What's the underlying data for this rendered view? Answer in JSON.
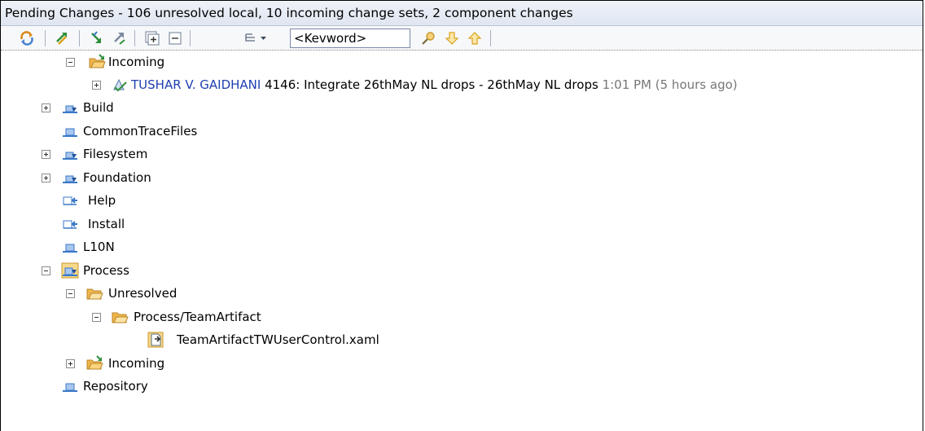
{
  "title": "Pending Changes - 106 unresolved local, 10 incoming change sets, 2 component changes",
  "toolbar": {
    "keyword_value": "<Kevword>",
    "buttons": [
      {
        "name": "refresh-icon"
      },
      {
        "name": "check-in-icon"
      },
      {
        "name": "accept-icon"
      },
      {
        "name": "deliver-icon"
      },
      {
        "name": "expand-all-icon"
      },
      {
        "name": "collapse-all-icon"
      },
      {
        "name": "filter-menu-icon"
      },
      {
        "name": "search-icon"
      },
      {
        "name": "next-down-arrow-icon"
      },
      {
        "name": "previous-up-arrow-icon"
      }
    ]
  },
  "tree": {
    "incoming_top": "Incoming",
    "changeset": {
      "user": "TUSHAR V. GAIDHANI",
      "description": "4146: Integrate 26thMay NL drops - 26thMay NL drops",
      "time": "1:01 PM (5 hours ago)"
    },
    "components": {
      "build": "Build",
      "commontracefiles": "CommonTraceFiles",
      "filesystem": "Filesystem",
      "foundation": "Foundation",
      "help": "Help",
      "install": "Install",
      "l10n": "L10N",
      "process": "Process",
      "repository": "Repository"
    },
    "unresolved": "Unresolved",
    "process_folder": "Process/TeamArtifact",
    "file": "TeamArtifactTWUserControl.xaml",
    "incoming_process": "Incoming"
  },
  "colors": {
    "changeset_user": "#1f3fb0",
    "timestamp": "#777777",
    "component_icon": "#3a78c8",
    "folder_icon": "#f0b64b"
  }
}
